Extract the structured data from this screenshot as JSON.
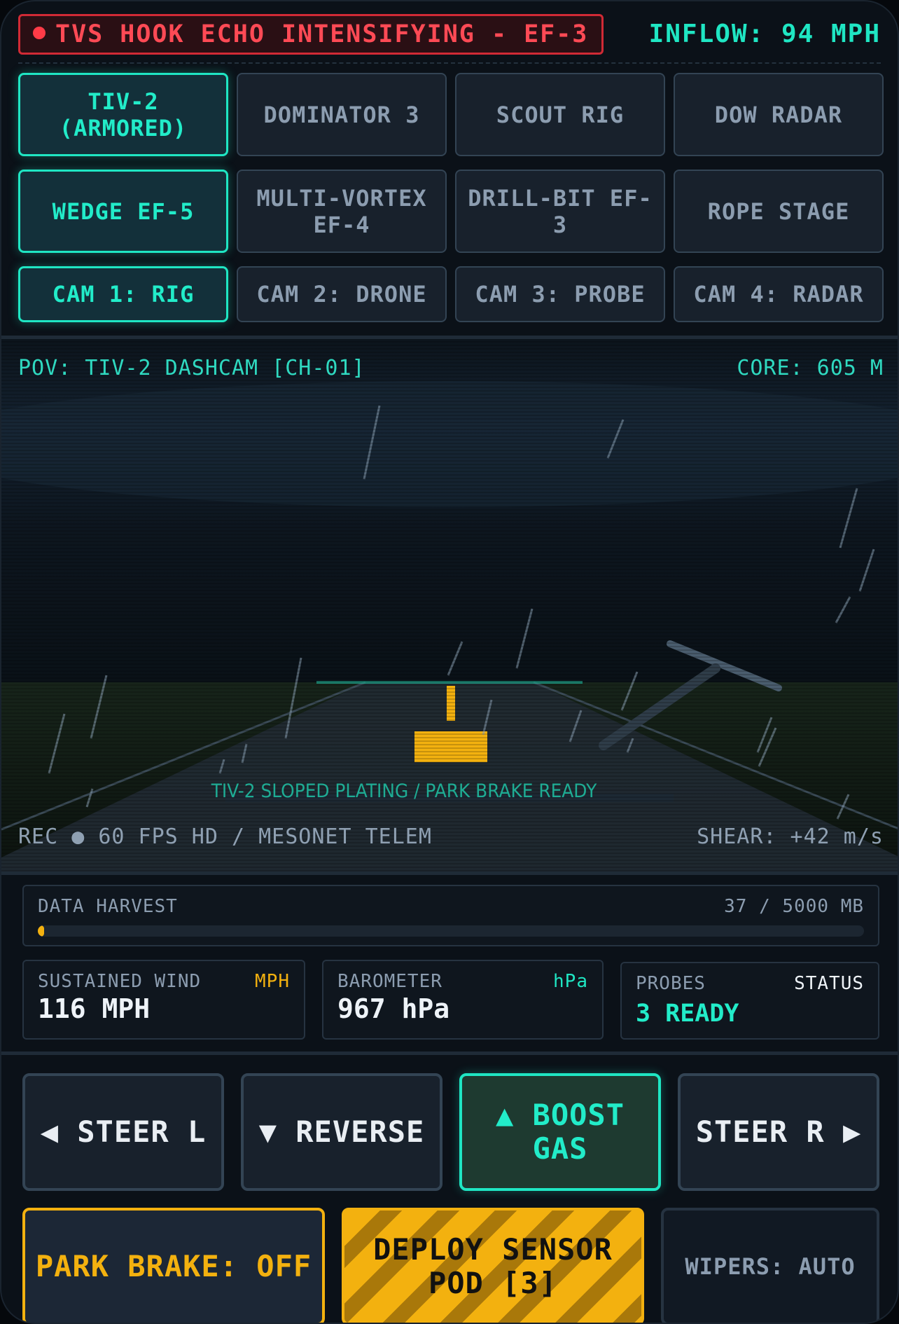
{
  "header": {
    "alert": "TVS HOOK ECHO INTENSIFYING - EF-3",
    "inflow": "INFLOW: 94 MPH"
  },
  "vehicles": [
    {
      "label": "TIV-2\n(ARMORED)",
      "active": true
    },
    {
      "label": "DOMINATOR 3",
      "active": false
    },
    {
      "label": "SCOUT RIG",
      "active": false
    },
    {
      "label": "DOW RADAR",
      "active": false
    }
  ],
  "tornado_types": [
    {
      "label": "WEDGE EF-5",
      "active": true
    },
    {
      "label": "MULTI-VORTEX\nEF-4",
      "active": false
    },
    {
      "label": "DRILL-BIT EF-\n3",
      "active": false
    },
    {
      "label": "ROPE STAGE",
      "active": false
    }
  ],
  "cameras": [
    {
      "label": "CAM 1: RIG",
      "active": true
    },
    {
      "label": "CAM 2: DRONE",
      "active": false
    },
    {
      "label": "CAM 3: PROBE",
      "active": false
    },
    {
      "label": "CAM 4: RADAR",
      "active": false
    }
  ],
  "viewport": {
    "pov": "POV: TIV-2 DASHCAM [CH-01]",
    "core": "CORE: 605 M",
    "rec": "REC ● 60 FPS HD / MESONET TELEM",
    "shear": "SHEAR: +42 m/s",
    "overlay": "TIV-2 SLOPED PLATING / PARK BRAKE READY"
  },
  "harvest": {
    "label": "DATA HARVEST",
    "value": "37 / 5000 MB",
    "fraction": 0.0074
  },
  "stats": {
    "wind": {
      "label": "SUSTAINED WIND",
      "unit": "MPH",
      "value": "116 MPH"
    },
    "baro": {
      "label": "BAROMETER",
      "unit": "hPa",
      "value": "967 hPa"
    },
    "probes": {
      "label": "PROBES",
      "unit": "STATUS",
      "value": "3 READY"
    }
  },
  "controls": {
    "steer_left": "◀ STEER L",
    "reverse": "▼ REVERSE",
    "boost": "▲ BOOST\nGAS",
    "steer_right": "STEER R ▶",
    "park_brake": "PARK BRAKE: OFF",
    "deploy": "DEPLOY SENSOR\nPOD [3]",
    "wipers": "WIPERS: AUTO"
  },
  "colors": {
    "accent": "#1fe6c3",
    "alert": "#ff4a55",
    "warning": "#f3b10f",
    "background": "#0b1118"
  }
}
